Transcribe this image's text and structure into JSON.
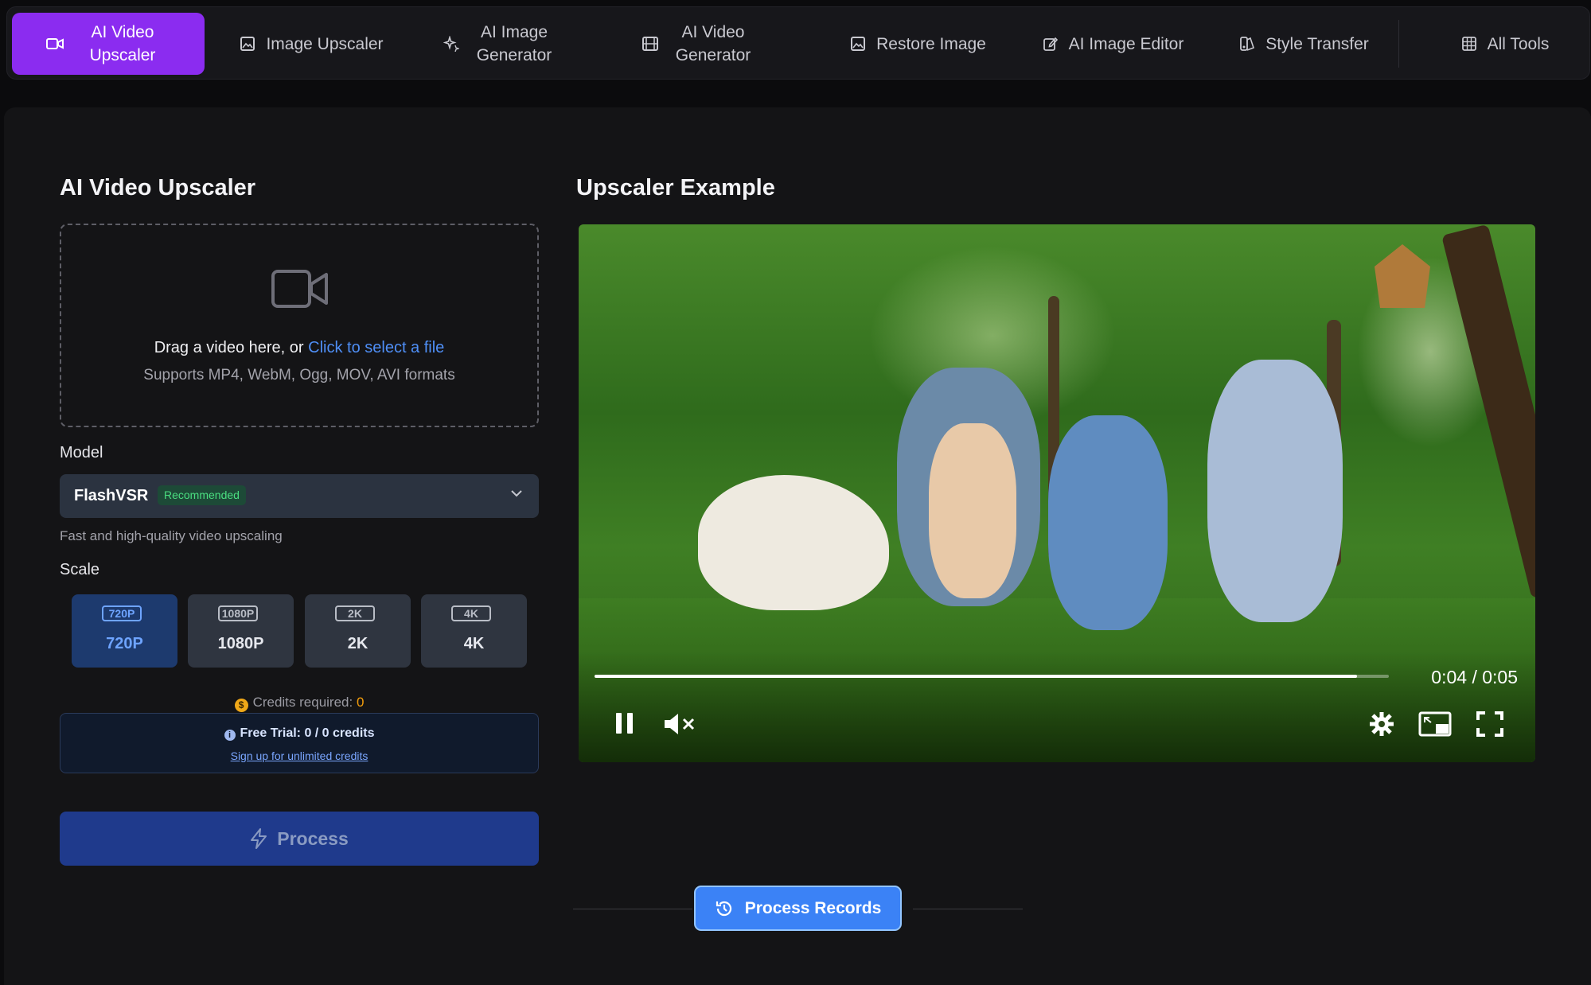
{
  "nav": {
    "items": [
      {
        "label": "AI Video\nUpscaler",
        "icon": "video-icon",
        "active": true
      },
      {
        "label": "Image Upscaler",
        "icon": "image-icon"
      },
      {
        "label": "AI Image\nGenerator",
        "icon": "sparkles-icon"
      },
      {
        "label": "AI Video\nGenerator",
        "icon": "film-icon"
      },
      {
        "label": "Restore Image",
        "icon": "image-icon"
      },
      {
        "label": "AI Image Editor",
        "icon": "edit-icon"
      },
      {
        "label": "Style Transfer",
        "icon": "palette-icon"
      },
      {
        "label": "All Tools",
        "icon": "grid-icon"
      }
    ]
  },
  "left": {
    "title": "AI Video Upscaler",
    "dropzone": {
      "text": "Drag a video here, or ",
      "link": "Click to select a file",
      "formats": "Supports MP4, WebM, Ogg, MOV, AVI formats"
    },
    "model": {
      "label": "Model",
      "selected": "FlashVSR",
      "badge": "Recommended",
      "hint": "Fast and high-quality video upscaling"
    },
    "scale": {
      "label": "Scale",
      "options": [
        {
          "icon_text": "720P",
          "label": "720P",
          "selected": true
        },
        {
          "icon_text": "1080P",
          "label": "1080P"
        },
        {
          "icon_text": "2K",
          "label": "2K"
        },
        {
          "icon_text": "4K",
          "label": "4K"
        }
      ]
    },
    "credits": {
      "label": "Credits required: ",
      "value": "0"
    },
    "trial": {
      "text": "Free Trial: 0 / 0 credits",
      "link": "Sign up for unlimited credits"
    },
    "process_label": "Process"
  },
  "right": {
    "title": "Upscaler Example",
    "video": {
      "time": "0:04 / 0:05",
      "progress": 0.96
    }
  },
  "records_label": "Process Records",
  "colors": {
    "accent": "#8b2cf0",
    "primary": "#3b82f6",
    "selected_scale": "#1d3a6e"
  }
}
